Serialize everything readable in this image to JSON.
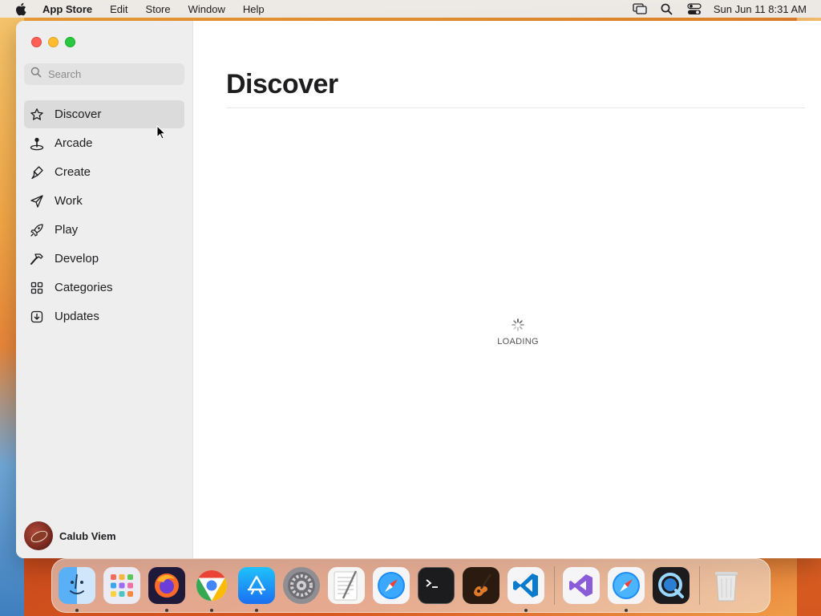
{
  "menubar": {
    "app_name": "App Store",
    "menus": [
      "Edit",
      "Store",
      "Window",
      "Help"
    ],
    "icons": [
      "screen-mirroring-icon",
      "spotlight-search-icon",
      "control-center-icon"
    ],
    "clock": "Sun Jun 11  8:31 AM"
  },
  "sidebar": {
    "search_placeholder": "Search",
    "items": [
      {
        "label": "Discover",
        "icon": "star-icon",
        "active": true
      },
      {
        "label": "Arcade",
        "icon": "joystick-icon",
        "active": false
      },
      {
        "label": "Create",
        "icon": "brush-icon",
        "active": false
      },
      {
        "label": "Work",
        "icon": "paper-plane-icon",
        "active": false
      },
      {
        "label": "Play",
        "icon": "rocket-icon",
        "active": false
      },
      {
        "label": "Develop",
        "icon": "hammer-icon",
        "active": false
      },
      {
        "label": "Categories",
        "icon": "grid-icon",
        "active": false
      },
      {
        "label": "Updates",
        "icon": "download-icon",
        "active": false
      }
    ],
    "user_name": "Calub Viem"
  },
  "main": {
    "title": "Discover",
    "loading_text": "LOADING"
  },
  "dock": {
    "apps": [
      "Finder",
      "Launchpad",
      "Firefox",
      "Chrome",
      "App Store",
      "System Settings",
      "TextEdit",
      "Safari",
      "Terminal",
      "GarageBand",
      "Visual Studio Code",
      "Visual Studio",
      "Safari Technology Preview",
      "QuickTime Player",
      "Trash"
    ]
  },
  "colors": {
    "accent": "#0a84ff",
    "sidebar_bg": "#efeeef",
    "active_item_bg": "#dcdbdc"
  }
}
